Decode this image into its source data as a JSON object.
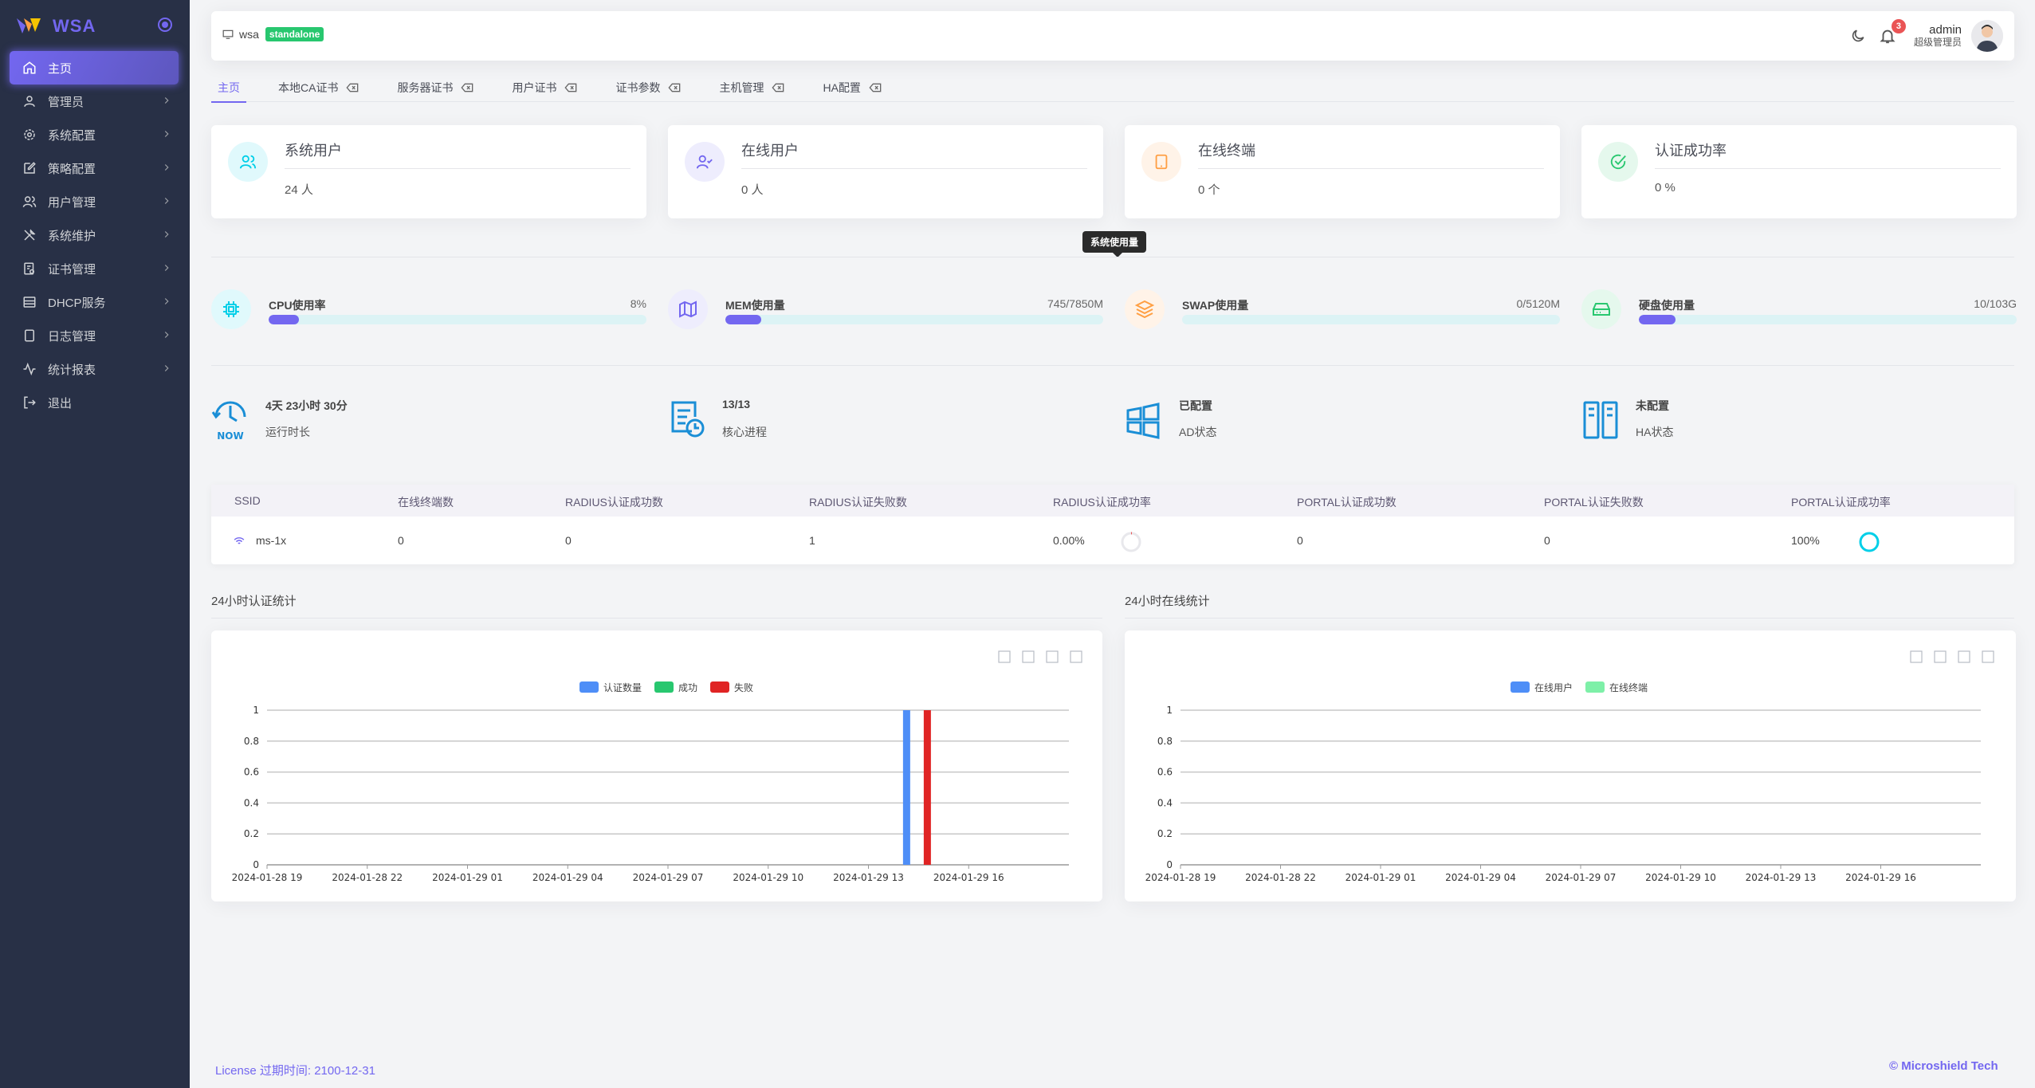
{
  "sidebar": {
    "brand": "WSA",
    "items": [
      {
        "label": "主页",
        "icon": "home-icon",
        "active": true
      },
      {
        "label": "管理员",
        "icon": "user-icon"
      },
      {
        "label": "系统配置",
        "icon": "settings-icon"
      },
      {
        "label": "策略配置",
        "icon": "edit-icon"
      },
      {
        "label": "用户管理",
        "icon": "users-icon"
      },
      {
        "label": "系统维护",
        "icon": "tools-icon"
      },
      {
        "label": "证书管理",
        "icon": "certificate-icon"
      },
      {
        "label": "DHCP服务",
        "icon": "server-icon"
      },
      {
        "label": "日志管理",
        "icon": "file-icon"
      },
      {
        "label": "统计报表",
        "icon": "activity-icon"
      },
      {
        "label": "退出",
        "icon": "logout-icon"
      }
    ]
  },
  "navbar": {
    "host": "wsa",
    "mode": "standalone",
    "notification_count": "3",
    "username": "admin",
    "role": "超级管理员"
  },
  "tabs": [
    {
      "label": "主页",
      "active": true,
      "closable": false
    },
    {
      "label": "本地CA证书",
      "closable": true
    },
    {
      "label": "服务器证书",
      "closable": true
    },
    {
      "label": "用户证书",
      "closable": true
    },
    {
      "label": "证书参数",
      "closable": true
    },
    {
      "label": "主机管理",
      "closable": true
    },
    {
      "label": "HA配置",
      "closable": true
    }
  ],
  "stats": [
    {
      "title": "系统用户",
      "value": "24 人",
      "icon": "users-icon",
      "color": "#00cfe8"
    },
    {
      "title": "在线用户",
      "value": "0 人",
      "icon": "user-check-icon",
      "color": "#7367f0"
    },
    {
      "title": "在线终端",
      "value": "0 个",
      "icon": "tablet-icon",
      "color": "#ff9f43"
    },
    {
      "title": "认证成功率",
      "value": "0 %",
      "icon": "check-circle-icon",
      "color": "#28c76f"
    }
  ],
  "tooltip": "系统使用量",
  "usage": [
    {
      "label": "CPU使用率",
      "value": "8%",
      "fraction": 0.08,
      "icon": "cpu-icon",
      "color": "#00cfe8"
    },
    {
      "label": "MEM使用量",
      "value": "745/7850M",
      "fraction": 0.095,
      "icon": "map-icon",
      "color": "#7367f0"
    },
    {
      "label": "SWAP使用量",
      "value": "0/5120M",
      "fraction": 0.0,
      "icon": "layers-icon",
      "color": "#ff9f43"
    },
    {
      "label": "硬盘使用量",
      "value": "10/103G",
      "fraction": 0.097,
      "icon": "hard-drive-icon",
      "color": "#28c76f"
    }
  ],
  "sysinfo": [
    {
      "value": "4天 23小时 30分",
      "label": "运行时长",
      "icon": "clock-now-icon",
      "icon_text": "NOW"
    },
    {
      "value": "13/13",
      "label": "核心进程",
      "icon": "process-icon"
    },
    {
      "value": "已配置",
      "label": "AD状态",
      "icon": "windows-icon"
    },
    {
      "value": "未配置",
      "label": "HA状态",
      "icon": "ha-servers-icon"
    }
  ],
  "ssid_table": {
    "headers": [
      "SSID",
      "在线终端数",
      "RADIUS认证成功数",
      "RADIUS认证失败数",
      "RADIUS认证成功率",
      "PORTAL认证成功数",
      "PORTAL认证失败数",
      "PORTAL认证成功率"
    ],
    "rows": [
      {
        "ssid": "ms-1x",
        "online": "0",
        "radius_ok": "0",
        "radius_fail": "1",
        "radius_rate": "0.00%",
        "portal_ok": "0",
        "portal_fail": "0",
        "portal_rate": "100%"
      }
    ]
  },
  "sections": {
    "auth_title": "24小时认证统计",
    "online_title": "24小时在线统计"
  },
  "chart_data": [
    {
      "type": "bar",
      "legend": [
        {
          "name": "认证数量",
          "color": "#4e8ef7"
        },
        {
          "name": "成功",
          "color": "#28c76f"
        },
        {
          "name": "失败",
          "color": "#e02424"
        }
      ],
      "x_ticks": [
        "2024-01-28 19",
        "2024-01-28 22",
        "2024-01-29 01",
        "2024-01-29 04",
        "2024-01-29 07",
        "2024-01-29 10",
        "2024-01-29 13",
        "2024-01-29 16"
      ],
      "y_ticks": [
        "0",
        "0.2",
        "0.4",
        "0.6",
        "0.8",
        "1"
      ],
      "ylim": [
        0,
        1
      ],
      "series": [
        {
          "name": "认证数量",
          "bars": [
            {
              "x": "2024-01-29 14",
              "y": 1
            }
          ]
        },
        {
          "name": "成功",
          "bars": []
        },
        {
          "name": "失败",
          "bars": [
            {
              "x": "2024-01-29 14",
              "y": 1
            }
          ]
        }
      ],
      "xlabel": "",
      "ylabel": ""
    },
    {
      "type": "line",
      "legend": [
        {
          "name": "在线用户",
          "color": "#4e8ef7"
        },
        {
          "name": "在线终端",
          "color": "#7ef0a8"
        }
      ],
      "x_ticks": [
        "2024-01-28 19",
        "2024-01-28 22",
        "2024-01-29 01",
        "2024-01-29 04",
        "2024-01-29 07",
        "2024-01-29 10",
        "2024-01-29 13",
        "2024-01-29 16"
      ],
      "y_ticks": [
        "0",
        "0.2",
        "0.4",
        "0.6",
        "0.8",
        "1"
      ],
      "ylim": [
        0,
        1
      ],
      "series": [
        {
          "name": "在线用户",
          "values": []
        },
        {
          "name": "在线终端",
          "values": []
        }
      ],
      "xlabel": "",
      "ylabel": ""
    }
  ],
  "footer": {
    "license": "License 过期时间: 2100-12-31",
    "copyright": "© Microshield Tech"
  }
}
